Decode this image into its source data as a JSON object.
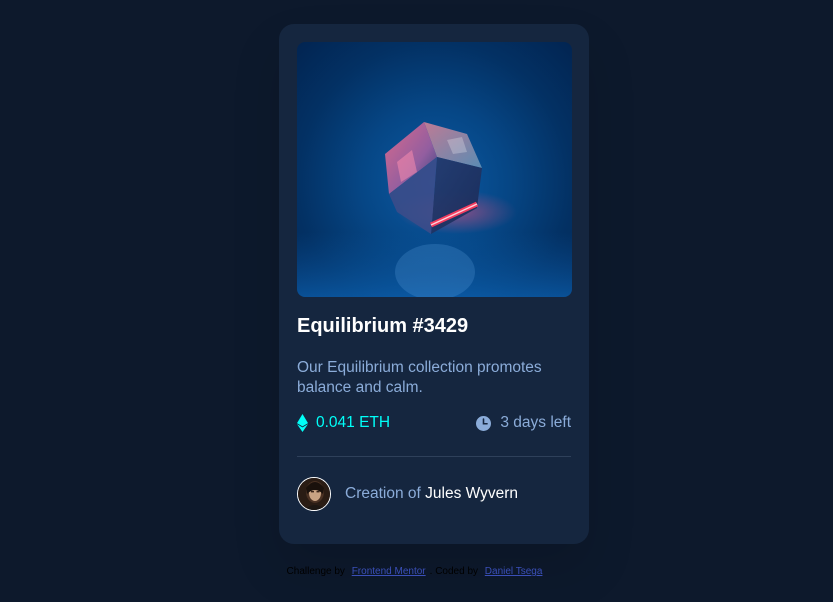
{
  "card": {
    "image_alt": "Equilibrium crystal cube",
    "title": "Equilibrium #3429",
    "description": "Our Equilibrium collection promotes balance and calm.",
    "price": "0.041 ETH",
    "price_icon": "ethereum-icon",
    "time_left": "3 days left",
    "time_icon": "clock-icon",
    "creator_prefix": "Creation of",
    "creator_name": "Jules Wyvern",
    "avatar_icon": "avatar"
  },
  "attribution": {
    "challenge_prefix": "Challenge by",
    "challenge_link": "Frontend Mentor",
    "separator": ".",
    "coded_prefix": "Coded by",
    "coded_link": "Daniel Tsega"
  },
  "colors": {
    "page_bg": "#0d192c",
    "card_bg": "#15263f",
    "accent_cyan": "#00fff8",
    "soft_blue": "#8bacd9",
    "white": "#ffffff",
    "line": "#2e405a"
  }
}
